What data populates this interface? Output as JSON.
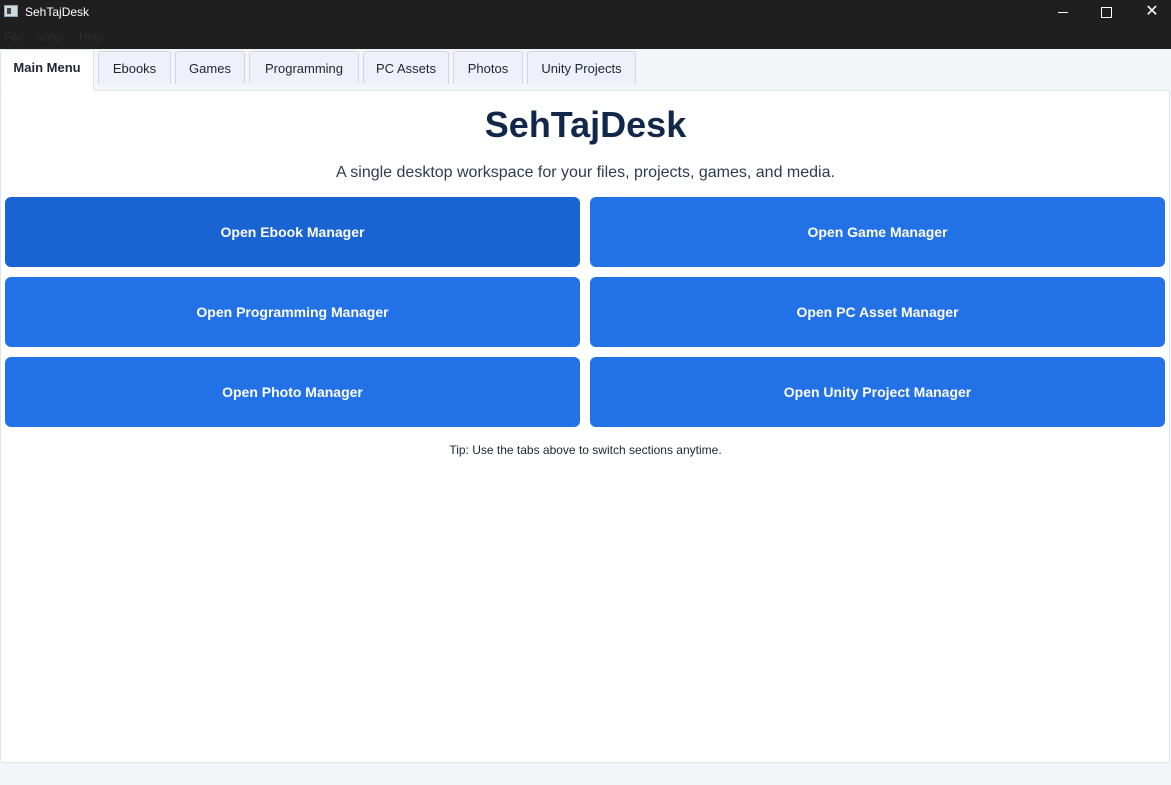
{
  "window": {
    "title": "SehTajDesk"
  },
  "menu": [
    "File",
    "View",
    "Help"
  ],
  "tabs": [
    {
      "label": "Main Menu",
      "active": true
    },
    {
      "label": "Ebooks",
      "active": false
    },
    {
      "label": "Games",
      "active": false
    },
    {
      "label": "Programming",
      "active": false
    },
    {
      "label": "PC Assets",
      "active": false
    },
    {
      "label": "Photos",
      "active": false
    },
    {
      "label": "Unity Projects",
      "active": false
    }
  ],
  "main": {
    "title": "SehTajDesk",
    "subtitle": "A single desktop workspace for your files, projects, games, and media.",
    "buttons": [
      "Open Ebook Manager",
      "Open Game Manager",
      "Open Programming Manager",
      "Open PC Asset Manager",
      "Open Photo Manager",
      "Open Unity Project Manager"
    ],
    "tip": "Tip: Use the tabs above to switch sections anytime."
  },
  "colors": {
    "accent": "#2271e6",
    "heading": "#11284b",
    "titlebar": "#1f1f1f"
  },
  "icons": [
    "app-icon",
    "minimize-icon",
    "maximize-icon",
    "close-icon"
  ]
}
